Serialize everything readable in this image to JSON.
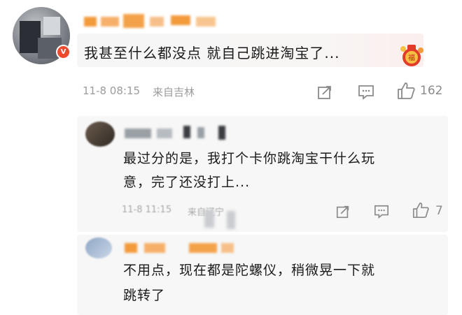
{
  "comment": {
    "text": "我甚至什么都没点 就自己跳进淘宝了...",
    "time": "11-8 08:15",
    "source": "来自吉林",
    "like_count": "162",
    "badge_icon": "vip-v-icon"
  },
  "reply1": {
    "line1": "最过分的是，我打个卡你跳淘宝干什么玩",
    "line2": "意，完了还没打上...",
    "time": "11-8 11:15",
    "source": "来自辽宁",
    "like_count": "7"
  },
  "reply2": {
    "line1": "不用点，现在都是陀螺仪，稍微晃一下就",
    "line2": "跳转了"
  },
  "colors": {
    "accent_orange": "#f39a3a",
    "badge_red": "#f04a2e",
    "meta_gray": "#9b9b9b"
  }
}
